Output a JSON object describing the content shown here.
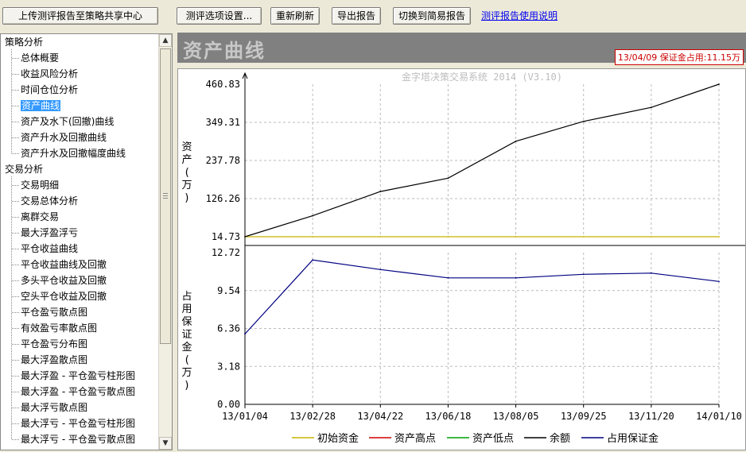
{
  "toolbar": {
    "upload_label": "上传测评报告至策略共享中心",
    "settings_label": "测评选项设置...",
    "refresh_label": "重新刷新",
    "export_label": "导出报告",
    "switch_label": "切换到简易报告",
    "help_link": "测评报告使用说明"
  },
  "tree": {
    "groups": [
      {
        "label": "策略分析",
        "items": [
          "总体概要",
          "收益风险分析",
          "时间仓位分析",
          "资产曲线",
          "资产及水下(回撤)曲线",
          "资产升水及回撤曲线",
          "资产升水及回撤幅度曲线"
        ]
      },
      {
        "label": "交易分析",
        "items": [
          "交易明细",
          "交易总体分析",
          "离群交易",
          "最大浮盈浮亏",
          "平仓收益曲线",
          "平仓收益曲线及回撤",
          "多头平仓收益及回撤",
          "空头平仓收益及回撤",
          "平仓盈亏散点图",
          "有效盈亏率散点图",
          "平仓盈亏分布图",
          "最大浮盈散点图",
          "最大浮盈 - 平仓盈亏柱形图",
          "最大浮盈 - 平仓盈亏散点图",
          "最大浮亏散点图",
          "最大浮亏 - 平仓盈亏柱形图",
          "最大浮亏 - 平仓盈亏散点图"
        ]
      }
    ],
    "selected": "资产曲线"
  },
  "panel": {
    "title": "资产曲线",
    "status": "13/04/09 保证金占用:11.15万"
  },
  "chart_data": [
    {
      "type": "line",
      "watermark": "金字塔决策交易系统 2014 (V3.10)",
      "ylabel": "资产(万)",
      "y_ticks": [
        "460.83",
        "349.31",
        "237.78",
        "126.26",
        "14.73"
      ],
      "ylim": [
        14.73,
        460.83
      ],
      "x": [
        "13/01/04",
        "13/02/28",
        "13/04/22",
        "13/06/18",
        "13/08/05",
        "13/09/25",
        "13/11/20",
        "14/01/10"
      ],
      "series": [
        {
          "name": "初始资金",
          "color": "#c8b400",
          "values": [
            14.73,
            14.73,
            14.73,
            14.73,
            14.73,
            14.73,
            14.73,
            14.73
          ]
        },
        {
          "name": "余额",
          "color": "#000000",
          "values": [
            14.73,
            76,
            147,
            186,
            294,
            352,
            393,
            460.83
          ]
        }
      ]
    },
    {
      "type": "line",
      "ylabel": "占用保证金(万)",
      "y_ticks": [
        "12.72",
        "9.54",
        "6.36",
        "3.18",
        "0.00"
      ],
      "ylim": [
        0,
        12.72
      ],
      "x": [
        "13/01/04",
        "13/02/28",
        "13/04/22",
        "13/06/18",
        "13/08/05",
        "13/09/25",
        "13/11/20",
        "14/01/10"
      ],
      "series": [
        {
          "name": "占用保证金",
          "color": "#000080",
          "values": [
            5.9,
            12.1,
            11.3,
            10.6,
            10.6,
            10.9,
            11.0,
            10.3
          ]
        }
      ]
    }
  ],
  "legend": [
    {
      "label": "初始资金",
      "color": "#c8b400"
    },
    {
      "label": "资产高点",
      "color": "#d00000"
    },
    {
      "label": "资产低点",
      "color": "#00a000"
    },
    {
      "label": "余额",
      "color": "#000000"
    },
    {
      "label": "占用保证金",
      "color": "#000080"
    }
  ]
}
